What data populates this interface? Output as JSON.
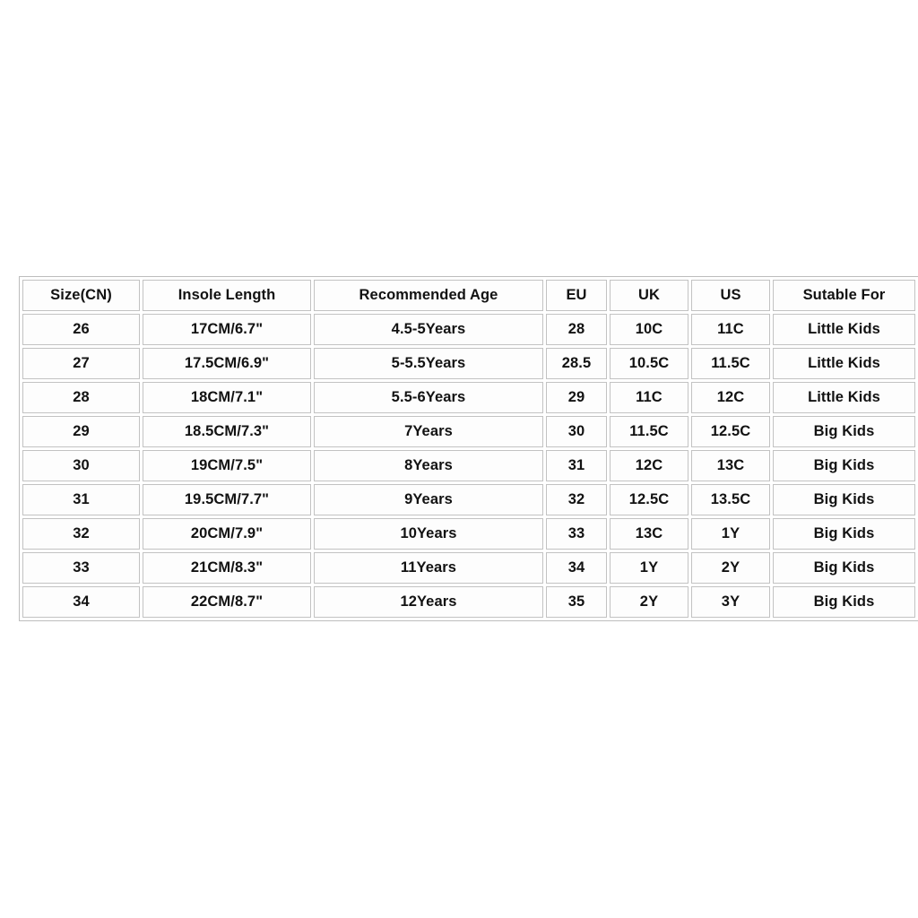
{
  "table": {
    "title": "",
    "columns": [
      {
        "key": "cn",
        "label": "Size(CN)"
      },
      {
        "key": "insole",
        "label": "Insole Length"
      },
      {
        "key": "age",
        "label": "Recommended Age"
      },
      {
        "key": "eu",
        "label": "EU"
      },
      {
        "key": "uk",
        "label": "UK"
      },
      {
        "key": "us",
        "label": "US"
      },
      {
        "key": "suit",
        "label": "Sutable For"
      }
    ],
    "rows": [
      {
        "cn": "26",
        "insole": "17CM/6.7\"",
        "age": "4.5-5Years",
        "eu": "28",
        "uk": "10C",
        "us": "11C",
        "suit": "Little Kids"
      },
      {
        "cn": "27",
        "insole": "17.5CM/6.9\"",
        "age": "5-5.5Years",
        "eu": "28.5",
        "uk": "10.5C",
        "us": "11.5C",
        "suit": "Little Kids"
      },
      {
        "cn": "28",
        "insole": "18CM/7.1\"",
        "age": "5.5-6Years",
        "eu": "29",
        "uk": "11C",
        "us": "12C",
        "suit": "Little Kids"
      },
      {
        "cn": "29",
        "insole": "18.5CM/7.3\"",
        "age": "7Years",
        "eu": "30",
        "uk": "11.5C",
        "us": "12.5C",
        "suit": "Big Kids"
      },
      {
        "cn": "30",
        "insole": "19CM/7.5\"",
        "age": "8Years",
        "eu": "31",
        "uk": "12C",
        "us": "13C",
        "suit": "Big Kids"
      },
      {
        "cn": "31",
        "insole": "19.5CM/7.7\"",
        "age": "9Years",
        "eu": "32",
        "uk": "12.5C",
        "us": "13.5C",
        "suit": "Big Kids"
      },
      {
        "cn": "32",
        "insole": "20CM/7.9\"",
        "age": "10Years",
        "eu": "33",
        "uk": "13C",
        "us": "1Y",
        "suit": "Big Kids"
      },
      {
        "cn": "33",
        "insole": "21CM/8.3\"",
        "age": "11Years",
        "eu": "34",
        "uk": "1Y",
        "us": "2Y",
        "suit": "Big Kids"
      },
      {
        "cn": "34",
        "insole": "22CM/8.7\"",
        "age": "12Years",
        "eu": "35",
        "uk": "2Y",
        "us": "3Y",
        "suit": "Big Kids"
      }
    ]
  },
  "colors": {
    "page_background": "#ffffff",
    "cell_background": "#fdfdfd",
    "border": "#c2c2c2",
    "text": "#121212"
  }
}
